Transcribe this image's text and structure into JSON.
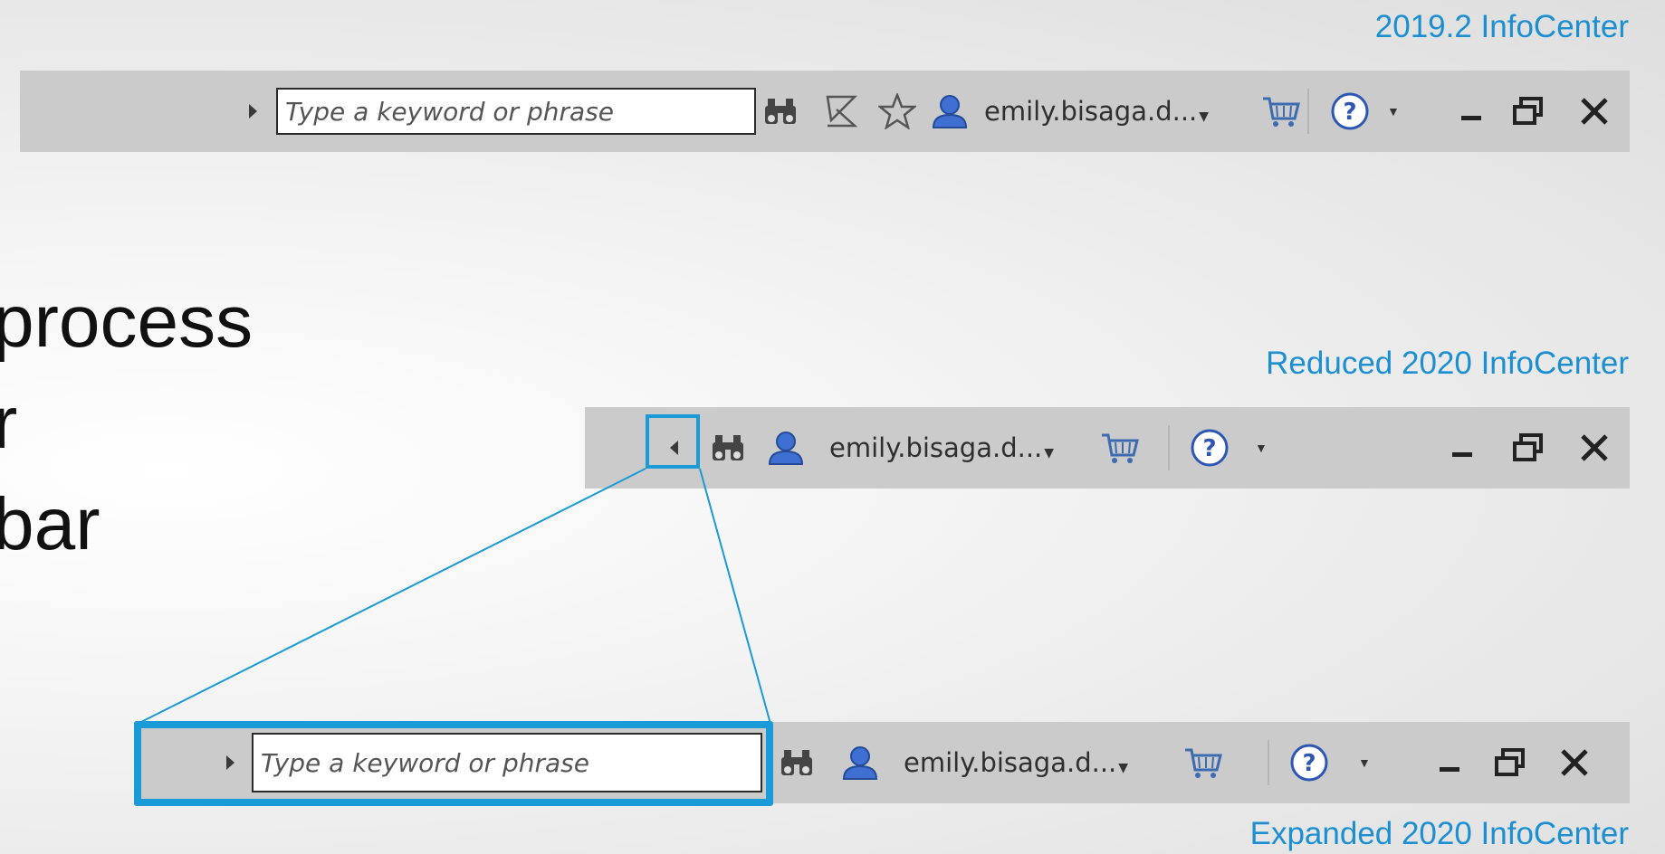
{
  "captions": {
    "top": "2019.2 InfoCenter",
    "middle": "Reduced 2020 InfoCenter",
    "bottom": "Expanded 2020 InfoCenter"
  },
  "bullets": [
    "process",
    "r",
    "bar"
  ],
  "toolbar": {
    "search_placeholder": "Type a keyword or phrase",
    "user": "emily.bisaga.d...",
    "icons": [
      "search-arrow-icon",
      "binoculars-icon",
      "satellite-icon",
      "star-icon",
      "user-icon",
      "cart-icon",
      "help-icon",
      "minimize-icon",
      "restore-icon",
      "close-icon"
    ]
  },
  "colors": {
    "accent": "#1a9ad6",
    "caption": "#1b8fd1",
    "bar": "#cbcbcb",
    "user_icon": "#3f6fd0"
  }
}
